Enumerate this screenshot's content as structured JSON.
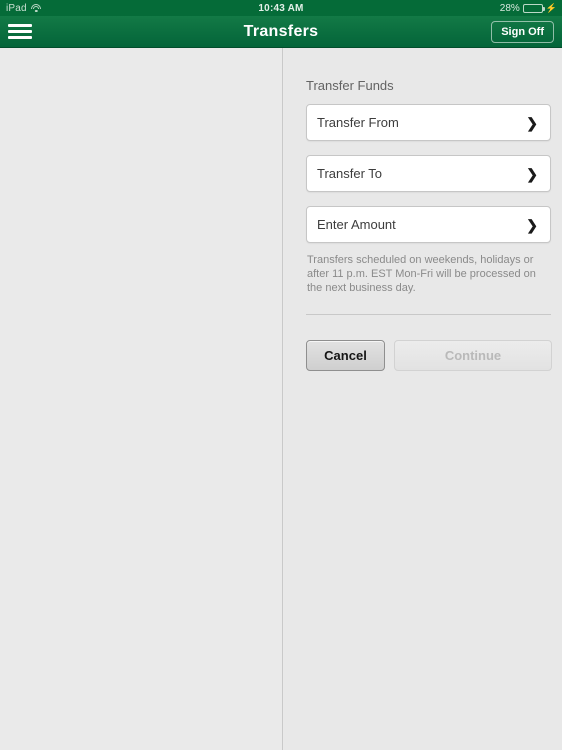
{
  "status_bar": {
    "device": "iPad",
    "wifi_icon": "wifi-icon",
    "time": "10:43 AM",
    "battery_percent": "28%",
    "battery_level": 28,
    "charging_icon": "lightning-bolt-icon"
  },
  "nav": {
    "menu_icon": "hamburger-menu-icon",
    "title": "Transfers",
    "sign_off_label": "Sign Off",
    "bar_color": "#0c7040"
  },
  "main": {
    "section_title": "Transfer Funds",
    "fields": [
      {
        "label": "Transfer From",
        "value": "",
        "chevron": "❯"
      },
      {
        "label": "Transfer To",
        "value": "",
        "chevron": "❯"
      },
      {
        "label": "Enter Amount",
        "value": "",
        "chevron": "❯"
      }
    ],
    "disclaimer": "Transfers scheduled on weekends, holidays or after 11 p.m. EST Mon-Fri will be processed on the next business day.",
    "buttons": {
      "cancel_label": "Cancel",
      "continue_label": "Continue",
      "continue_disabled": true
    }
  }
}
